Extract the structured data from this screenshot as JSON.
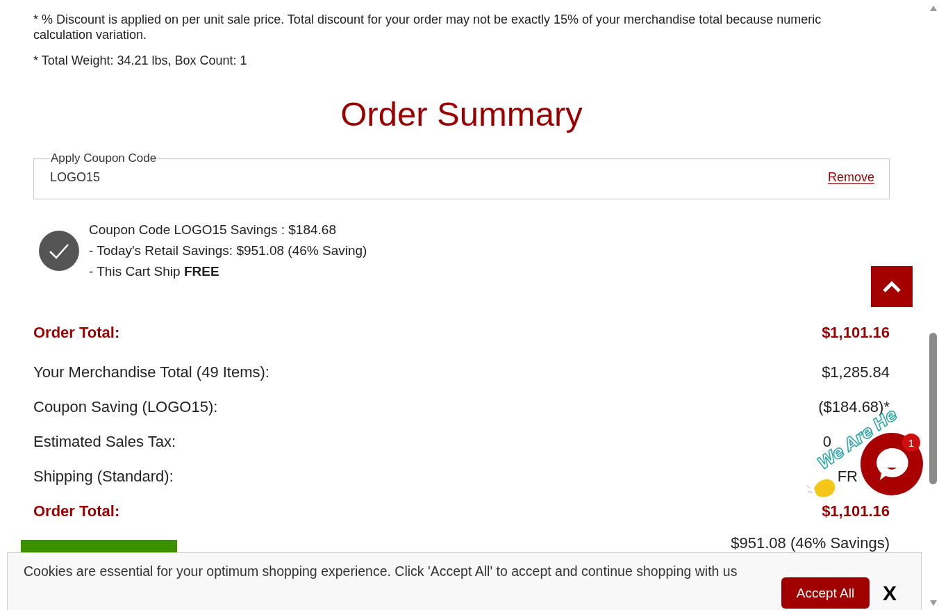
{
  "notes": [
    "* % Discount is applied on per unit sale price. Total discount for your order may not be exactly 15% of your merchandise total because numeric calculation variation.",
    "* Total Weight: 34.21 lbs, Box Count: 1"
  ],
  "title": "Order Summary",
  "coupon": {
    "legend": "Apply Coupon Code",
    "value": "LOGO15",
    "remove": "Remove"
  },
  "savings": [
    "Coupon Code LOGO15 Savings : $184.68",
    "- Today's Retail Savings: $951.08 (46% Saving)",
    "- This Cart Ship **FREE**"
  ],
  "summary_rows": [
    {
      "kind": "total",
      "label": "Order Total:",
      "value": "$1,101.16"
    },
    {
      "kind": "line",
      "label": "Your Merchandise Total (49 Items):",
      "value": "$1,285.84"
    },
    {
      "kind": "line",
      "label": "Coupon Saving (LOGO15):",
      "value": "($184.68)*"
    },
    {
      "kind": "line",
      "label": "Estimated Sales Tax:",
      "value": "0"
    },
    {
      "kind": "line",
      "label": "Shipping (Standard):",
      "value": "FR"
    },
    {
      "kind": "total",
      "label": "Order Total:",
      "value": "$1,101.16"
    }
  ],
  "savings_total": "$951.08 (46% Savings)",
  "cookie_banner": {
    "text": "Cookies are essential for your optimum shopping experience. Click 'Accept All' to accept and continue shopping with us",
    "accept": "Accept All",
    "close": "X"
  },
  "chat": {
    "caption": "We Are He",
    "badge": "1"
  }
}
